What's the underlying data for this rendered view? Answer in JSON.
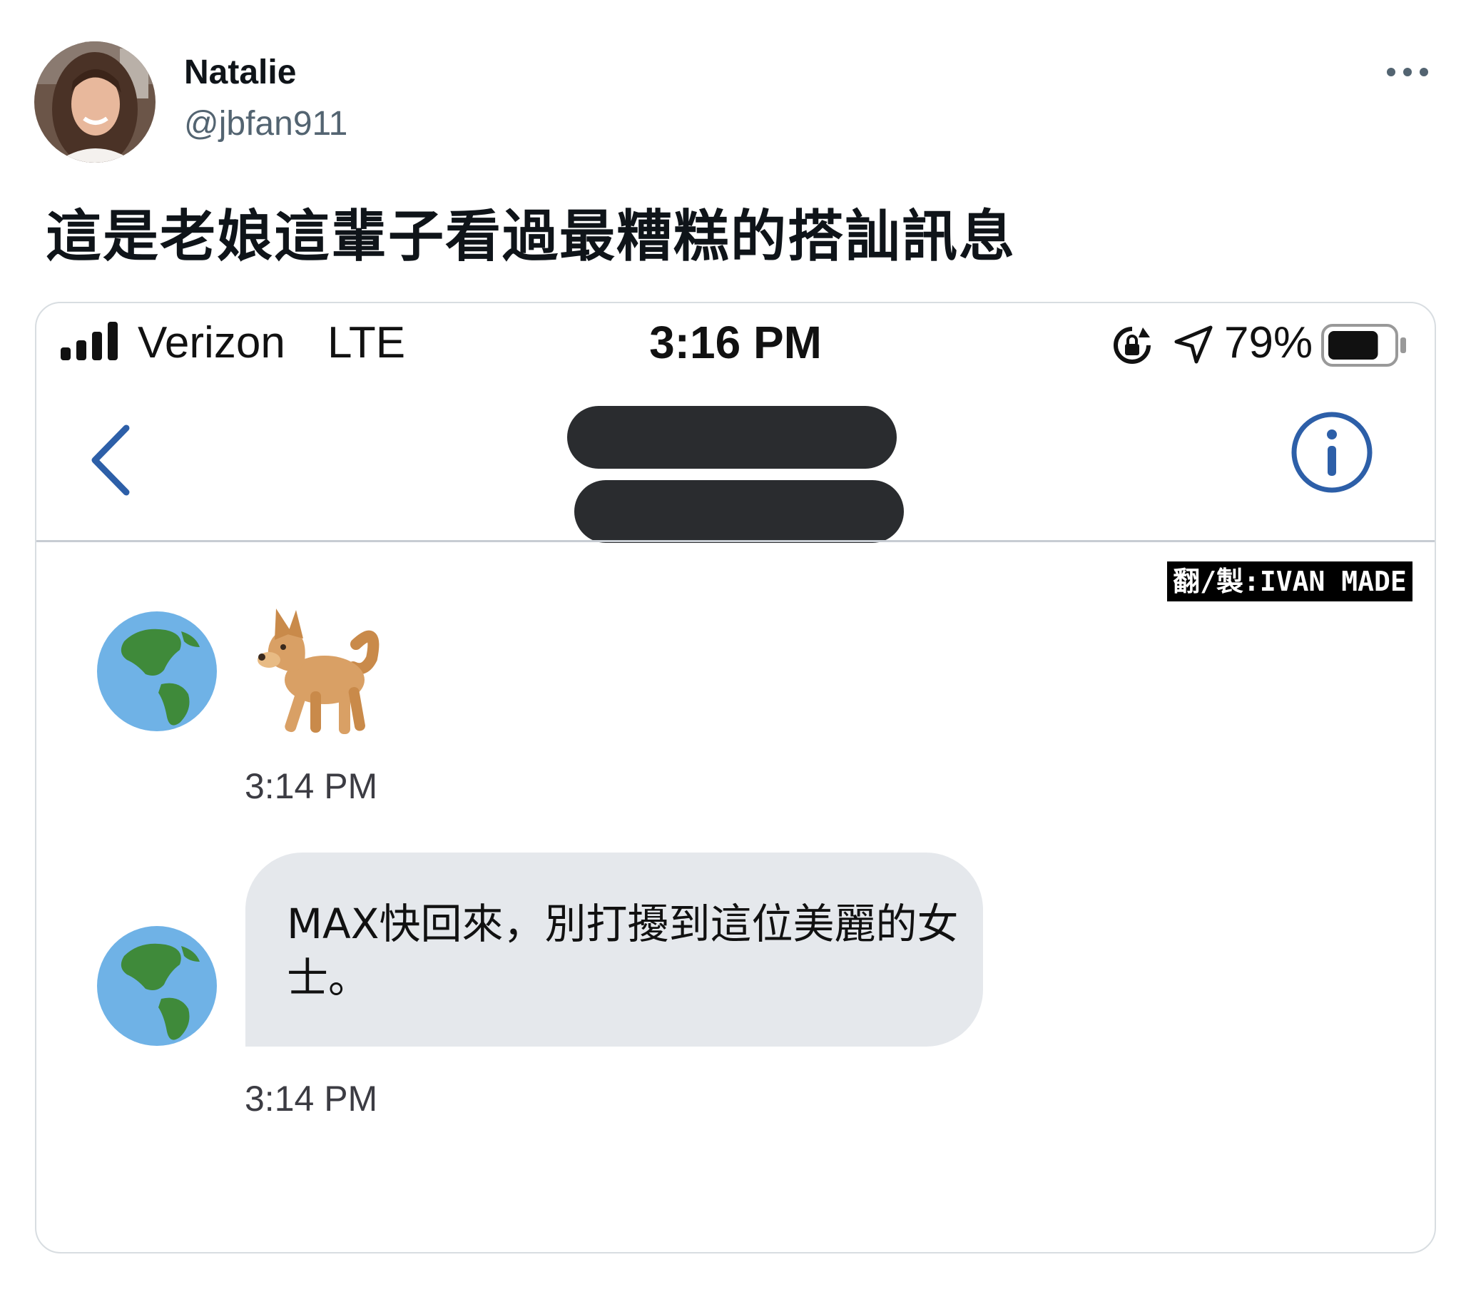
{
  "tweet": {
    "display_name": "Natalie",
    "handle": "@jbfan911",
    "text": "這是老娘這輩子看過最糟糕的搭訕訊息",
    "more_icon": "more-horizontal-icon"
  },
  "phone": {
    "status_bar": {
      "carrier": "Verizon",
      "network": "LTE",
      "time": "3:16 PM",
      "battery_percent": "79%",
      "battery_level": 0.79,
      "icons": [
        "signal-icon",
        "rotation-lock-icon",
        "location-arrow-icon",
        "battery-icon"
      ]
    },
    "nav": {
      "back_icon": "chevron-left-icon",
      "info_icon": "info-icon",
      "accent_color": "#2d5fa8"
    },
    "credit_label": "翻/製:IVAN MADE",
    "messages": [
      {
        "type": "emoji",
        "sender_avatar": "globe-americas-emoji",
        "content_icon": "dog-emoji",
        "time": "3:14 PM"
      },
      {
        "type": "text",
        "sender_avatar": "globe-americas-emoji",
        "text": "MAX快回來，別打擾到這位美麗的女士。",
        "time": "3:14 PM",
        "bubble_color": "#e5e8ec"
      }
    ]
  }
}
